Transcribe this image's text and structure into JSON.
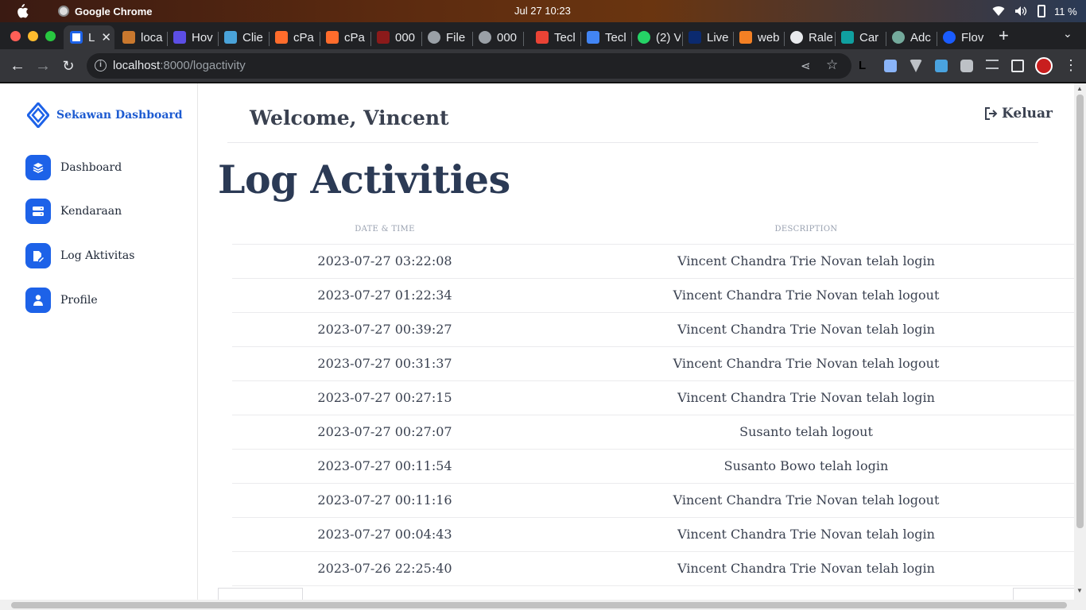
{
  "os": {
    "app_name": "Google Chrome",
    "clock": "Jul 27  10:23",
    "battery": "11 %"
  },
  "browser": {
    "tabs": [
      {
        "label": "L",
        "active": true
      },
      {
        "label": "loca"
      },
      {
        "label": "Hov"
      },
      {
        "label": "Clie"
      },
      {
        "label": "cPa"
      },
      {
        "label": "cPa"
      },
      {
        "label": "000"
      },
      {
        "label": "File"
      },
      {
        "label": "000"
      },
      {
        "label": "Tecl"
      },
      {
        "label": "Tecl"
      },
      {
        "label": "(2) V"
      },
      {
        "label": "Live"
      },
      {
        "label": "web"
      },
      {
        "label": "Rale"
      },
      {
        "label": "Car"
      },
      {
        "label": "Adc"
      },
      {
        "label": "Flov"
      }
    ],
    "new_tab": "+",
    "url_host": "localhost",
    "url_rest": ":8000/logactivity",
    "ext_l": "L"
  },
  "sidebar": {
    "brand": "Sekawan Dashboard",
    "items": [
      {
        "label": "Dashboard",
        "icon": "layers-icon"
      },
      {
        "label": "Kendaraan",
        "icon": "server-icon"
      },
      {
        "label": "Log Aktivitas",
        "icon": "edit-document-icon"
      },
      {
        "label": "Profile",
        "icon": "user-icon"
      }
    ]
  },
  "header": {
    "welcome": "Welcome, Vincent",
    "logout": "Keluar"
  },
  "page": {
    "title": "Log Activities"
  },
  "table": {
    "columns": [
      "DATE & TIME",
      "DESCRIPTION"
    ],
    "rows": [
      [
        "2023-07-27 03:22:08",
        "Vincent Chandra Trie Novan telah login"
      ],
      [
        "2023-07-27 01:22:34",
        "Vincent Chandra Trie Novan telah logout"
      ],
      [
        "2023-07-27 00:39:27",
        "Vincent Chandra Trie Novan telah login"
      ],
      [
        "2023-07-27 00:31:37",
        "Vincent Chandra Trie Novan telah logout"
      ],
      [
        "2023-07-27 00:27:15",
        "Vincent Chandra Trie Novan telah login"
      ],
      [
        "2023-07-27 00:27:07",
        "Susanto telah logout"
      ],
      [
        "2023-07-27 00:11:54",
        "Susanto Bowo telah login"
      ],
      [
        "2023-07-27 00:11:16",
        "Vincent Chandra Trie Novan telah logout"
      ],
      [
        "2023-07-27 00:04:43",
        "Vincent Chandra Trie Novan telah login"
      ],
      [
        "2023-07-26 22:25:40",
        "Vincent Chandra Trie Novan telah login"
      ]
    ]
  },
  "colors": {
    "accent": "#1d62e8",
    "title": "#2b3a55",
    "text": "#3a4150"
  }
}
